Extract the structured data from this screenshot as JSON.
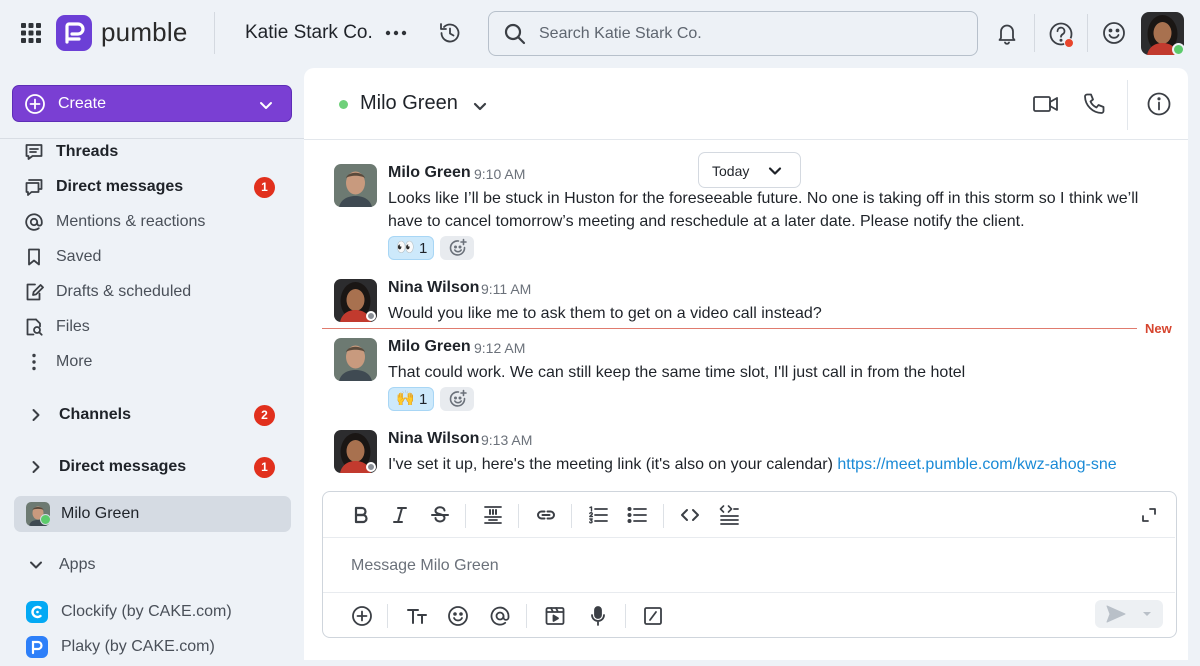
{
  "app": {
    "name": "pumble",
    "brand_color": "#6c3fd6"
  },
  "topbar": {
    "workspace": "Katie Stark Co.",
    "search_placeholder": "Search Katie Stark Co."
  },
  "sidebar": {
    "create_label": "Create",
    "nav": [
      {
        "label": "Threads",
        "icon": "threads-icon",
        "bold": true
      },
      {
        "label": "Direct messages",
        "icon": "direct-messages-icon",
        "bold": true,
        "badge": "1"
      },
      {
        "label": "Mentions & reactions",
        "icon": "at-icon"
      },
      {
        "label": "Saved",
        "icon": "bookmark-icon"
      },
      {
        "label": "Drafts & scheduled",
        "icon": "drafts-icon"
      },
      {
        "label": "Files",
        "icon": "files-icon"
      },
      {
        "label": "More",
        "icon": "more-vertical-icon"
      }
    ],
    "sections": {
      "channels": {
        "label": "Channels",
        "badge": "2"
      },
      "direct_messages": {
        "label": "Direct messages",
        "badge": "1"
      },
      "apps": {
        "label": "Apps"
      }
    },
    "active_dm": {
      "label": "Milo Green"
    },
    "apps": [
      {
        "label": "Clockify (by CAKE.com)",
        "color": "#03a9f4"
      },
      {
        "label": "Plaky (by CAKE.com)",
        "color": "#2d7ff9"
      }
    ]
  },
  "channel": {
    "name": "Milo Green",
    "status_color": "#6fd07a"
  },
  "date_pill": "Today",
  "messages": [
    {
      "author": "Milo Green",
      "time": "9:10 AM",
      "text": "Looks like I’ll be stuck in Huston for the foreseeable future. No one is taking off in this storm so I think we’ll have to cancel tomorrow’s meeting and reschedule at a later date. Please notify the client.",
      "reaction": {
        "emoji": "👀",
        "count": "1"
      }
    },
    {
      "author": "Nina Wilson",
      "time": "9:11 AM",
      "text": "Would you like me to ask them to get on a video call instead?"
    },
    {
      "author": "Milo Green",
      "time": "9:12 AM",
      "text": "That could work. We can still keep the same time slot, I'll just call in from the hotel",
      "reaction": {
        "emoji": "🙌",
        "count": "1"
      }
    },
    {
      "author": "Nina Wilson",
      "time": "9:13 AM",
      "text": "I've set it up, here's the meeting link (it's also on your calendar) ",
      "link": "https://meet.pumble.com/kwz-ahog-sne"
    }
  ],
  "new_marker": "New",
  "composer": {
    "placeholder": "Message Milo Green"
  }
}
